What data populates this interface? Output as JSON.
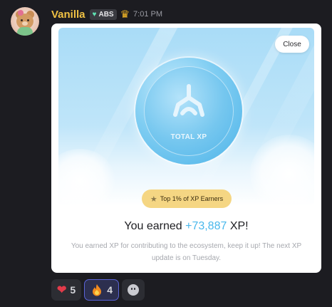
{
  "message": {
    "username": "Vanilla",
    "badge_label": "ABS",
    "timestamp": "7:01 PM"
  },
  "card": {
    "close_label": "Close",
    "coin_label": "TOTAL XP",
    "rank_label": "Top 1% of XP Earners",
    "headline_prefix": "You earned ",
    "headline_xp": "+73,887",
    "headline_suffix": " XP!",
    "subtext": "You earned XP for contributing to the ecosystem, keep it up! The next XP update is on Tuesday."
  },
  "reactions": [
    {
      "icon": "heart-icon",
      "count": "5"
    },
    {
      "icon": "fire-icon",
      "count": "4",
      "active": true
    },
    {
      "icon": "add-reaction-icon"
    }
  ],
  "colors": {
    "username": "#f0c244",
    "xp_accent": "#4ab8ec",
    "rank_pill": "#f5d683"
  }
}
